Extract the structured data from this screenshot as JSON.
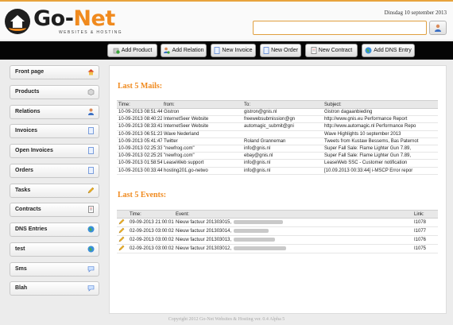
{
  "header": {
    "logo_name_go": "Go-",
    "logo_name_net": "Net",
    "logo_tagline": "WEBSITES & HOSTING",
    "date": "Dinsdag 10 september 2013",
    "search_value": "",
    "accent": "#f08a1e"
  },
  "toolbar": {
    "buttons": [
      {
        "label": "Add Product",
        "icon": "add-product-icon"
      },
      {
        "label": "Add Relation",
        "icon": "add-relation-icon"
      },
      {
        "label": "New Invoice",
        "icon": "invoice-icon"
      },
      {
        "label": "New Order",
        "icon": "order-icon"
      },
      {
        "label": "New Contract",
        "icon": "contract-icon"
      },
      {
        "label": "Add DNS Entry",
        "icon": "globe-icon"
      }
    ]
  },
  "sidebar": {
    "items": [
      {
        "label": "Front page",
        "icon": "home-icon"
      },
      {
        "label": "Products",
        "icon": "box-icon"
      },
      {
        "label": "Relations",
        "icon": "user-icon"
      },
      {
        "label": "Invoices",
        "icon": "document-icon"
      },
      {
        "label": "Open Invoices",
        "icon": "document-icon"
      },
      {
        "label": "Orders",
        "icon": "document-icon"
      },
      {
        "label": "Tasks",
        "icon": "pencil-icon"
      },
      {
        "label": "Contracts",
        "icon": "contract-icon"
      },
      {
        "label": "DNS Entries",
        "icon": "globe-icon"
      },
      {
        "label": "test",
        "icon": "globe-icon"
      },
      {
        "label": "Sms",
        "icon": "speech-bubble-icon"
      },
      {
        "label": "Blah",
        "icon": "speech-bubble-icon"
      }
    ]
  },
  "mails": {
    "title": "Last 5 Mails:",
    "columns": [
      "Time:",
      "from:",
      "To:",
      "Subject:"
    ],
    "rows": [
      [
        "10-09-2013 08:51:44",
        "Gistron",
        "gistron@gnis.nl",
        "Gistron dagaanbieding"
      ],
      [
        "10-09-2013 08:40:22",
        "InternetSeer Website",
        "freewebsubmission@gn",
        "http://www.gnis.eu Performance Report"
      ],
      [
        "10-09-2013 08:33:41",
        "InternetSeer Website",
        "automagic_submit@gni",
        "http://www.automagic.nl Performance Repo"
      ],
      [
        "10-09-2013 06:51:23",
        "Wave Nederland",
        "",
        "Wave Highlights 10 september 2013"
      ],
      [
        "10-09-2013 05:41:47",
        "Twitter",
        "Roland Granneman",
        "Tweets from Kustaw Bessems, Bas Paternot"
      ],
      [
        "10-09-2013 02:25:33",
        "\"newfrog.com\"",
        "info@gnis.nl",
        "Super Fall Sale: Flame Lighter Gun 7.89,"
      ],
      [
        "10-09-2013 02:25:29",
        "\"newfrog.com\"",
        "ebay@gnis.nl",
        "Super Fall Sale: Flame Lighter Gun 7.89,"
      ],
      [
        "10-09-2013 01:58:54",
        "LeaseWeb support",
        "info@gnis.nl",
        "LeaseWeb SSC - Customer notification"
      ],
      [
        "10-09-2013 00:33:44",
        "hosting201.go-netwo",
        "info@gnis.nl",
        "[10.09.2013 00:33:44] i-MSCP Error repor"
      ]
    ]
  },
  "events": {
    "title": "Last 5 Events:",
    "columns": [
      "",
      "Time:",
      "Event:",
      "Link:"
    ],
    "rows": [
      [
        "09-09-2013 21:00:01",
        "Nieuw factuur 201303015,",
        "I1078"
      ],
      [
        "02-09-2013 03:00:02",
        "Nieuw factuur 201303014,",
        "I1077"
      ],
      [
        "02-09-2013 03:00:02",
        "Nieuw factuur 201303013,",
        "I1076"
      ],
      [
        "02-09-2013 03:00:02",
        "Nieuw factuur 201303012,",
        "I1075"
      ]
    ]
  },
  "footer": "Copyright 2012 Go-Net Websites & Hosting ver. 0.4 Alpha 5"
}
